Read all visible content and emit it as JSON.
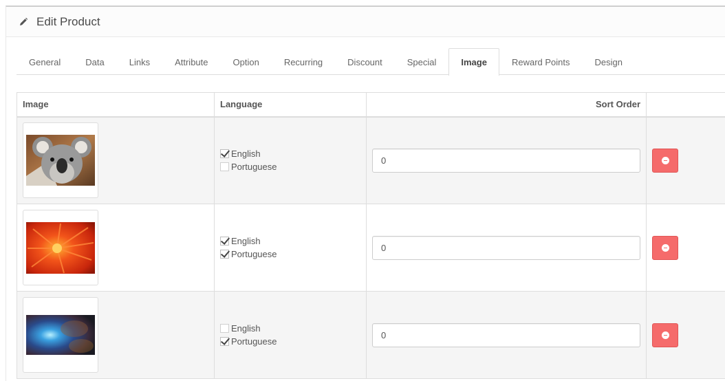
{
  "header": {
    "title": "Edit Product",
    "icon": "pencil-icon"
  },
  "tabs": [
    {
      "label": "General"
    },
    {
      "label": "Data"
    },
    {
      "label": "Links"
    },
    {
      "label": "Attribute"
    },
    {
      "label": "Option"
    },
    {
      "label": "Recurring"
    },
    {
      "label": "Discount"
    },
    {
      "label": "Special"
    },
    {
      "label": "Image",
      "active": true
    },
    {
      "label": "Reward Points"
    },
    {
      "label": "Design"
    }
  ],
  "table": {
    "headers": {
      "image": "Image",
      "language": "Language",
      "sort_order": "Sort Order"
    },
    "rows": [
      {
        "image": "koala",
        "languages": [
          {
            "label": "English",
            "checked": true
          },
          {
            "label": "Portuguese",
            "checked": false
          }
        ],
        "sort_order": "0"
      },
      {
        "image": "chrysanthemum",
        "languages": [
          {
            "label": "English",
            "checked": true
          },
          {
            "label": "Portuguese",
            "checked": true
          }
        ],
        "sort_order": "0"
      },
      {
        "image": "nebula",
        "languages": [
          {
            "label": "English",
            "checked": false
          },
          {
            "label": "Portuguese",
            "checked": true
          }
        ],
        "sort_order": "0"
      }
    ]
  },
  "colors": {
    "remove_button": "#f56b6b",
    "row_stripe": "#f5f5f5",
    "border": "#dddddd"
  }
}
